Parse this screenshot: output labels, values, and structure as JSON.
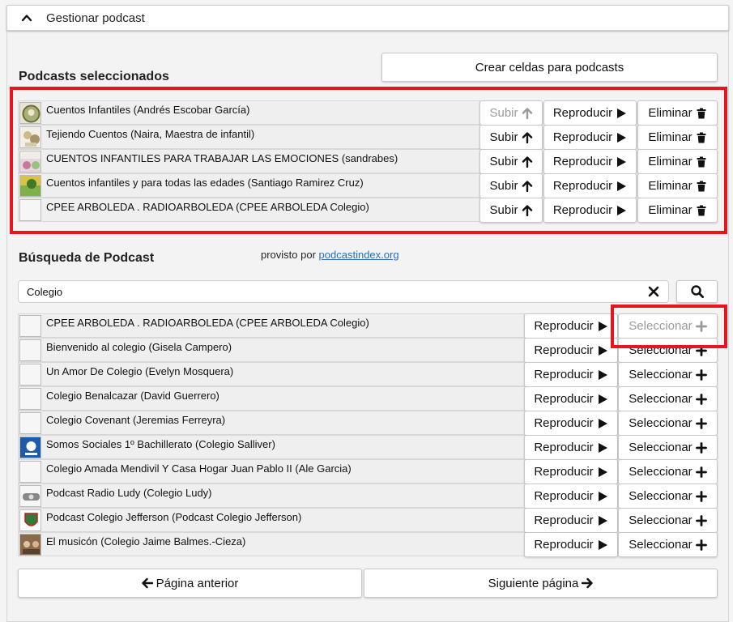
{
  "header": {
    "title": "Gestionar podcast"
  },
  "create_cells_label": "Crear celdas para podcasts",
  "selected": {
    "title": "Podcasts seleccionados",
    "up_label": "Subir",
    "play_label": "Reproducir",
    "delete_label": "Eliminar",
    "items": [
      {
        "label": "Cuentos Infantiles (Andrés Escobar García)"
      },
      {
        "label": "Tejiendo Cuentos (Naira, Maestra de infantil)"
      },
      {
        "label": "CUENTOS INFANTILES PARA TRABAJAR LAS EMOCIONES (sandrabes)"
      },
      {
        "label": "Cuentos infantiles y para todas las edades (Santiago Ramirez Cruz)"
      },
      {
        "label": "CPEE ARBOLEDA . RADIOARBOLEDA (CPEE ARBOLEDA Colegio)"
      }
    ]
  },
  "search": {
    "title": "Búsqueda de Podcast",
    "provided_prefix": "provisto por",
    "provided_link": "podcastindex.org",
    "query": "Colegio",
    "play_label": "Reproducir",
    "select_label": "Seleccionar",
    "results": [
      {
        "label": "CPEE ARBOLEDA . RADIOARBOLEDA (CPEE ARBOLEDA Colegio)"
      },
      {
        "label": "Bienvenido al colegio (Gisela Campero)"
      },
      {
        "label": "Un Amor De Colegio (Evelyn Mosquera)"
      },
      {
        "label": "Colegio Benalcazar (David Guerrero)"
      },
      {
        "label": "Colegio Covenant (Jeremias Ferreyra)"
      },
      {
        "label": "Somos Sociales 1º Bachillerato (Colegio Salliver)"
      },
      {
        "label": "Colegio Amada Mendivil Y Casa Hogar Juan Pablo II (Ale Garcia)"
      },
      {
        "label": "Podcast Radio Ludy (Colegio Ludy)"
      },
      {
        "label": "Podcast Colegio Jefferson (Podcast Colegio Jefferson)"
      },
      {
        "label": "El musicón (Colegio Jaime Balmes.-Cieza)"
      }
    ]
  },
  "pagination": {
    "prev_label": "Página anterior",
    "next_label": "Siguiente página"
  },
  "colors": {
    "highlight": "#e8141f",
    "link": "#2a6ebb",
    "disabled_text": "#9a9a9a"
  }
}
